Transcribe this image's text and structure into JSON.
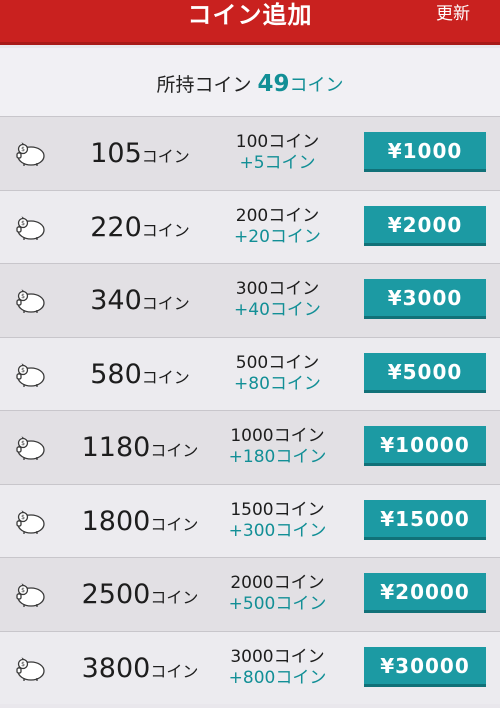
{
  "header": {
    "title": "コイン追加",
    "refresh_label": "更新",
    "accent_color": "#c9211f"
  },
  "balance": {
    "label": "所持コイン",
    "amount": "49",
    "unit": "コイン"
  },
  "packages": [
    {
      "icon": "piggy-bank-icon",
      "coins": "105",
      "unit": "コイン",
      "base": "100コイン",
      "bonus": "+5コイン",
      "price": "¥1000"
    },
    {
      "icon": "piggy-bank-icon",
      "coins": "220",
      "unit": "コイン",
      "base": "200コイン",
      "bonus": "+20コイン",
      "price": "¥2000"
    },
    {
      "icon": "piggy-bank-icon",
      "coins": "340",
      "unit": "コイン",
      "base": "300コイン",
      "bonus": "+40コイン",
      "price": "¥3000"
    },
    {
      "icon": "piggy-bank-icon",
      "coins": "580",
      "unit": "コイン",
      "base": "500コイン",
      "bonus": "+80コイン",
      "price": "¥5000"
    },
    {
      "icon": "piggy-bank-icon",
      "coins": "1180",
      "unit": "コイン",
      "base": "1000コイン",
      "bonus": "+180コイン",
      "price": "¥10000"
    },
    {
      "icon": "piggy-bank-icon",
      "coins": "1800",
      "unit": "コイン",
      "base": "1500コイン",
      "bonus": "+300コイン",
      "price": "¥15000"
    },
    {
      "icon": "piggy-bank-icon",
      "coins": "2500",
      "unit": "コイン",
      "base": "2000コイン",
      "bonus": "+500コイン",
      "price": "¥20000"
    },
    {
      "icon": "piggy-bank-icon",
      "coins": "3800",
      "unit": "コイン",
      "base": "3000コイン",
      "bonus": "+800コイン",
      "price": "¥30000"
    }
  ],
  "colors": {
    "button": "#1c9aa3",
    "bonus_text": "#128f96"
  }
}
